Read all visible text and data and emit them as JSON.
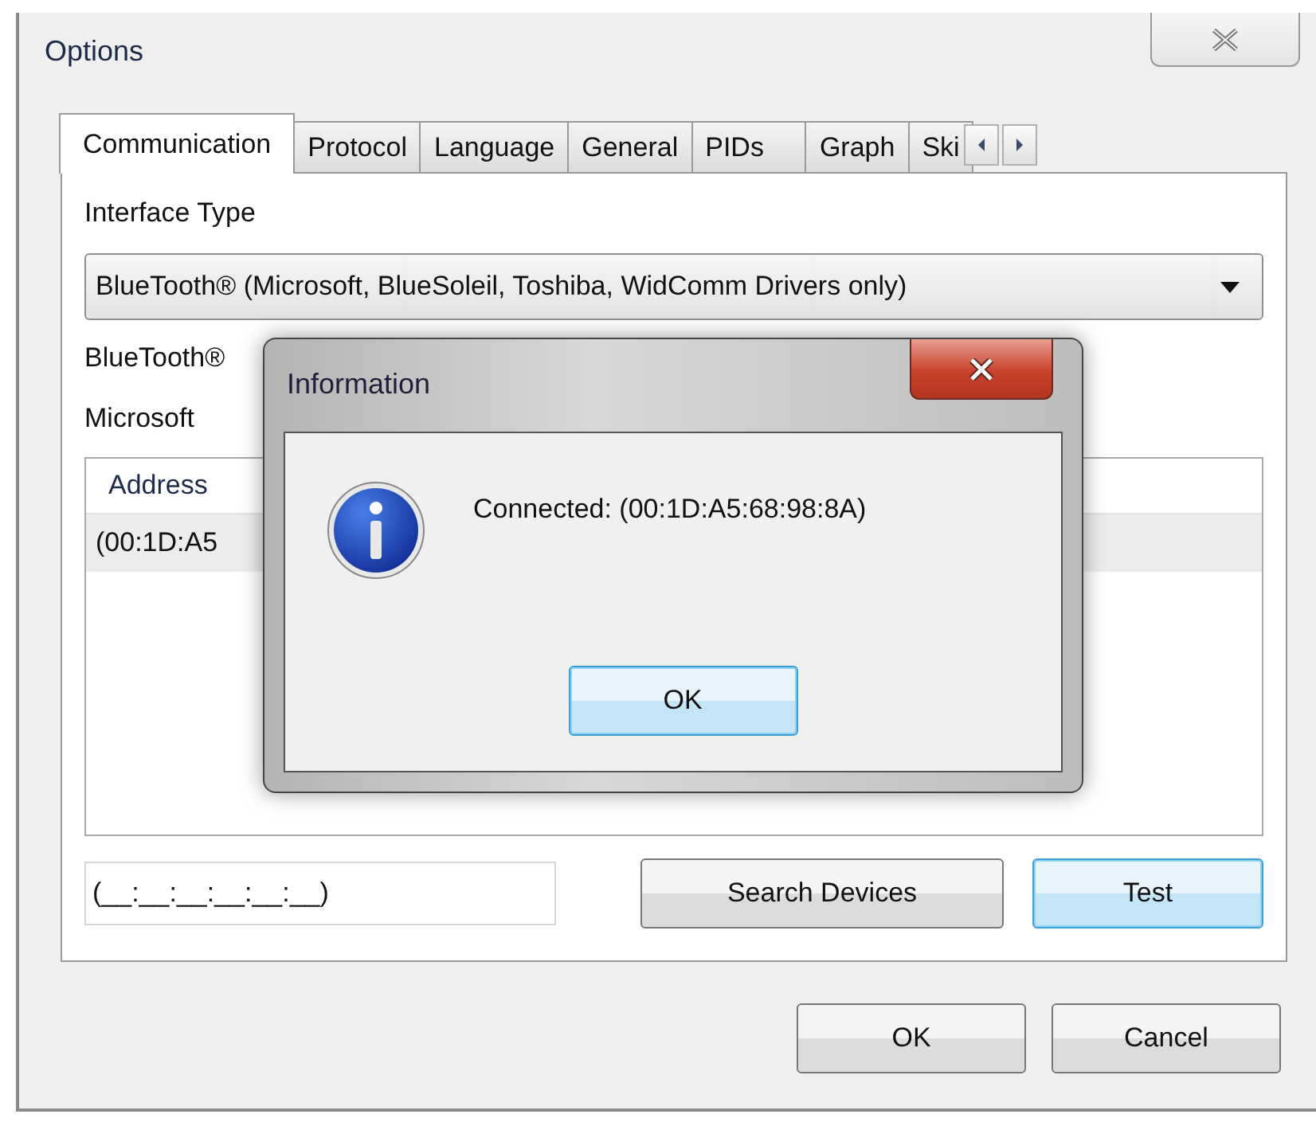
{
  "window": {
    "title": "Options"
  },
  "tabs": [
    {
      "label": "Communication",
      "selected": true
    },
    {
      "label": "Protocol",
      "selected": false
    },
    {
      "label": "Language",
      "selected": false
    },
    {
      "label": "General",
      "selected": false
    },
    {
      "label": "PIDs",
      "selected": false
    },
    {
      "label": "Graph",
      "selected": false
    },
    {
      "label": "Ski",
      "selected": false
    }
  ],
  "interface_type": {
    "label": "Interface Type",
    "value": "BlueTooth® (Microsoft, BlueSoleil, Toshiba, WidComm Drivers only)"
  },
  "labels": [
    "BlueTooth®",
    "Microsoft"
  ],
  "device_list": {
    "columns": [
      "Address"
    ],
    "rows": [
      {
        "cells": [
          "(00:1D:A5"
        ],
        "selected": true
      }
    ]
  },
  "address_field": {
    "value": "(__:__:__:__:__:__)"
  },
  "panel_buttons": [
    {
      "label": "Search Devices",
      "focused": false
    },
    {
      "label": "Test",
      "focused": true
    }
  ],
  "dialog_buttons": [
    {
      "label": "OK",
      "focused": false
    },
    {
      "label": "Cancel",
      "focused": false
    }
  ],
  "message_box": {
    "title": "Information",
    "message": "Connected: (00:1D:A5:68:98:8A)",
    "button": {
      "label": "OK",
      "focused": true
    }
  }
}
